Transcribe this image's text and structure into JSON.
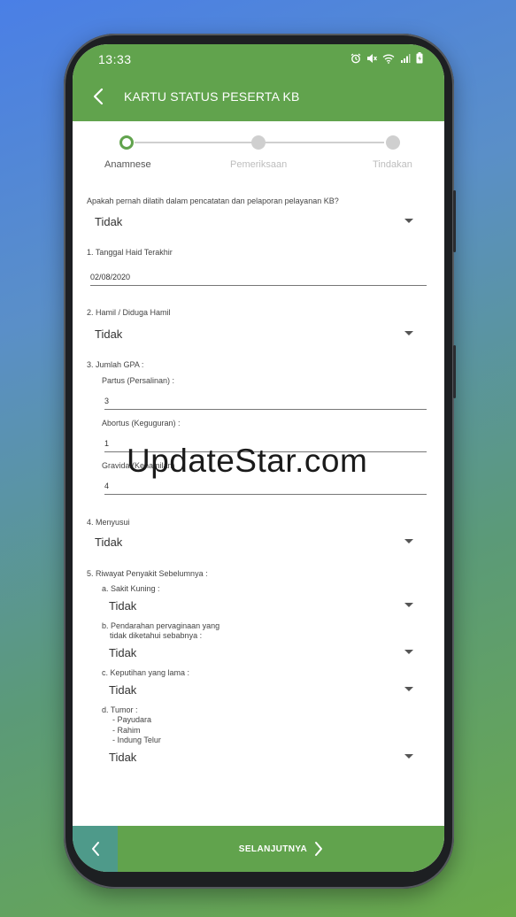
{
  "status_bar": {
    "time": "13:33"
  },
  "header": {
    "title": "KARTU STATUS PESERTA KB"
  },
  "stepper": {
    "steps": [
      "Anamnese",
      "Pemeriksaan",
      "Tindakan"
    ]
  },
  "form": {
    "q_training": {
      "label": "Apakah pernah dilatih dalam pencatatan dan pelaporan pelayanan KB?",
      "value": "Tidak"
    },
    "q1": {
      "label": "1. Tanggal Haid Terakhir",
      "value": "02/08/2020"
    },
    "q2": {
      "label": "2. Hamil / Diduga Hamil",
      "value": "Tidak"
    },
    "q3": {
      "label": "3. Jumlah GPA :",
      "partus": {
        "label": "Partus (Persalinan)    :",
        "value": "3"
      },
      "abortus": {
        "label": "Abortus (Keguguran) :",
        "value": "1"
      },
      "gravida": {
        "label": "Gravida (Kehamilan)",
        "value": "4"
      }
    },
    "q4": {
      "label": "4. Menyusui",
      "value": "Tidak"
    },
    "q5": {
      "label": "5. Riwayat Penyakit Sebelumnya :",
      "a": {
        "label": "a. Sakit Kuning :",
        "value": "Tidak"
      },
      "b": {
        "label_line1": "b. Pendarahan pervaginaan yang",
        "label_line2": "tidak diketahui sebabnya :",
        "value": "Tidak"
      },
      "c": {
        "label": "c. Keputihan yang lama :",
        "value": "Tidak"
      },
      "d": {
        "label": "d. Tumor :",
        "items": [
          "- Payudara",
          "- Rahim",
          "- Indung Telur"
        ],
        "value": "Tidak"
      }
    }
  },
  "footer": {
    "next_label": "SELANJUTNYA"
  },
  "watermark": "UpdateStar.com",
  "colors": {
    "primary": "#61a34d",
    "prev_button": "#4e9a8a"
  }
}
